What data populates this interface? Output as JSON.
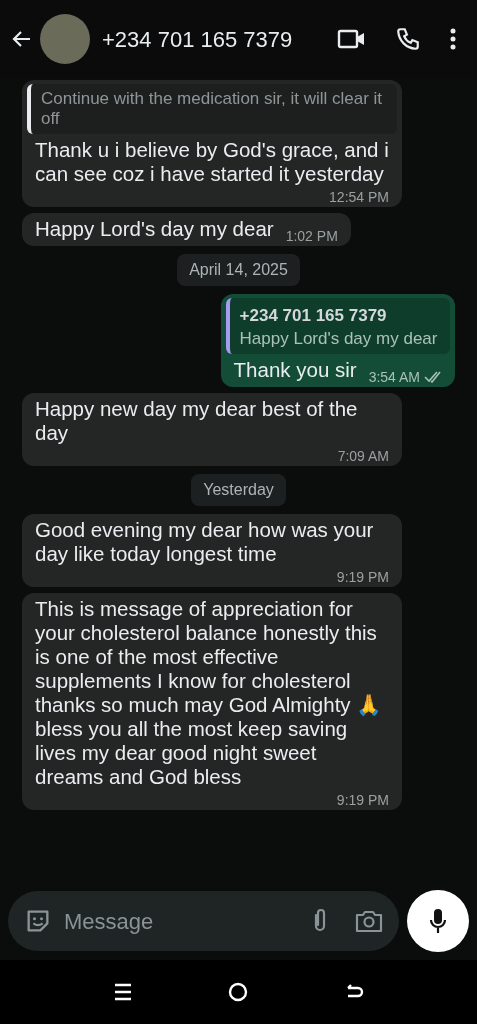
{
  "header": {
    "contact": "+234 701 165 7379"
  },
  "chat": [
    {
      "kind": "message",
      "outgoing": false,
      "quote": {
        "text": "Continue with the medication sir, it will clear it off"
      },
      "text": "Thank u i believe by God's grace, and i can see coz i have started it yesterday",
      "time": "12:54 PM"
    },
    {
      "kind": "message",
      "outgoing": false,
      "text": "Happy Lord's day my dear",
      "time": "1:02 PM"
    },
    {
      "kind": "date",
      "text": "April 14, 2025"
    },
    {
      "kind": "message",
      "outgoing": true,
      "quote": {
        "author": "+234 701 165 7379",
        "text": "Happy Lord's day my dear"
      },
      "text": "Thank you sir",
      "time": "3:54 AM",
      "read": false
    },
    {
      "kind": "message",
      "outgoing": false,
      "text": "Happy new day my dear best of the day",
      "time": "7:09 AM"
    },
    {
      "kind": "date",
      "text": "Yesterday"
    },
    {
      "kind": "message",
      "outgoing": false,
      "text": "Good evening my dear how was your day like today longest time",
      "time": "9:19 PM"
    },
    {
      "kind": "message",
      "outgoing": false,
      "text": "This is message of appreciation for your cholesterol balance honestly this is one of the most effective supplements I know for cholesterol thanks so much may God Almighty 🙏 bless you all the most keep saving lives my dear good night sweet dreams and God bless",
      "time": "9:19 PM"
    }
  ],
  "composer": {
    "placeholder": "Message"
  }
}
